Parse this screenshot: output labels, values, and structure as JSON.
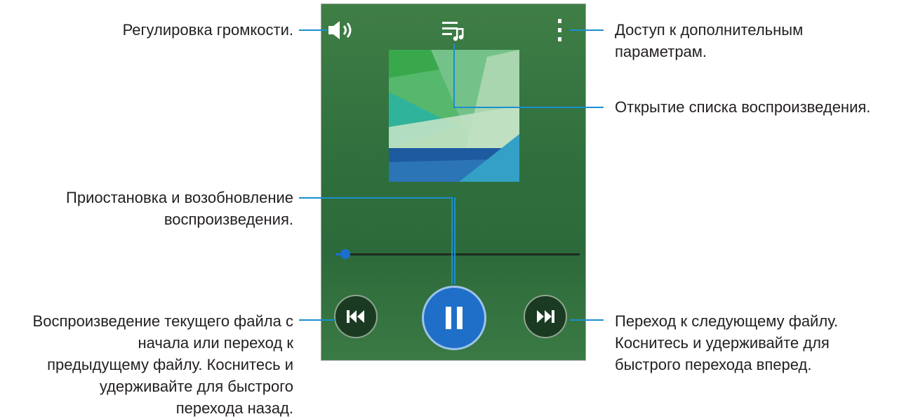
{
  "callouts": {
    "volume": "Регулировка громкости.",
    "more_options": "Доступ к дополнительным параметрам.",
    "more_options_line1": "Доступ к дополнительным",
    "more_options_line2": "параметрам.",
    "playlist": "Открытие списка воспроизведения.",
    "pause_resume_line1": "Приостановка и возобновление",
    "pause_resume_line2": "воспроизведения.",
    "previous_line1": "Воспроизведение текущего файла с",
    "previous_line2": "начала или переход к",
    "previous_line3": "предыдущему файлу. Коснитесь и",
    "previous_line4": "удерживайте для быстрого",
    "previous_line5": "перехода назад.",
    "next_line1": "Переход к следующему файлу.",
    "next_line2": "Коснитесь и удерживайте для",
    "next_line3": "быстрого перехода вперед."
  },
  "player": {
    "progress": 0.04,
    "icons": {
      "volume": "speaker-volume-icon",
      "playlist": "playlist-icon",
      "more": "more-options-icon",
      "previous": "previous-track-icon",
      "pause": "pause-icon",
      "next": "next-track-icon"
    },
    "colors": {
      "accent": "#1a8fcf",
      "play_button": "#1f6fc8",
      "background": "#2f6f3d"
    }
  }
}
